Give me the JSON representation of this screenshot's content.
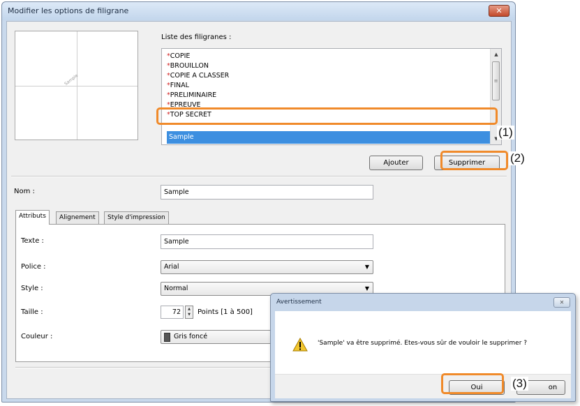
{
  "main_window": {
    "title": "Modifier les options de filigrane",
    "close_glyph": "✕",
    "list_label": "Liste des filigranes :",
    "list_items": [
      "COPIE",
      "BROUILLON",
      "COPIE A CLASSER",
      "FINAL",
      "PRELIMINAIRE",
      "EPREUVE",
      "TOP SECRET"
    ],
    "list_star": "*",
    "selected_item": "Sample",
    "preview_watermark": "Sample",
    "buttons": {
      "add": "Ajouter",
      "delete": "Supprimer"
    },
    "name_label": "Nom :",
    "name_value": "Sample",
    "tabs": [
      "Attributs",
      "Alignement",
      "Style d'impression"
    ],
    "attributes": {
      "text_label": "Texte :",
      "text_value": "Sample",
      "font_label": "Police :",
      "font_value": "Arial",
      "style_label": "Style :",
      "style_value": "Normal",
      "size_label": "Taille :",
      "size_value": "72",
      "size_unit": "Points [1 à 500]",
      "color_label": "Couleur :",
      "color_value": "Gris foncé",
      "color_swatch": "#555555"
    }
  },
  "warning_dialog": {
    "title": "Avertissement",
    "close_glyph": "✕",
    "message": "'Sample' va être supprimé. Etes-vous sûr de vouloir le supprimer ?",
    "ok_label": "Oui",
    "no_label_partial": "on",
    "icon": "warning-icon"
  },
  "callouts": [
    "(1)",
    "(2)",
    "(3)"
  ],
  "colors": {
    "highlight": "#f08a2a",
    "selection": "#3d8fe0",
    "close": "#c34a2c"
  }
}
